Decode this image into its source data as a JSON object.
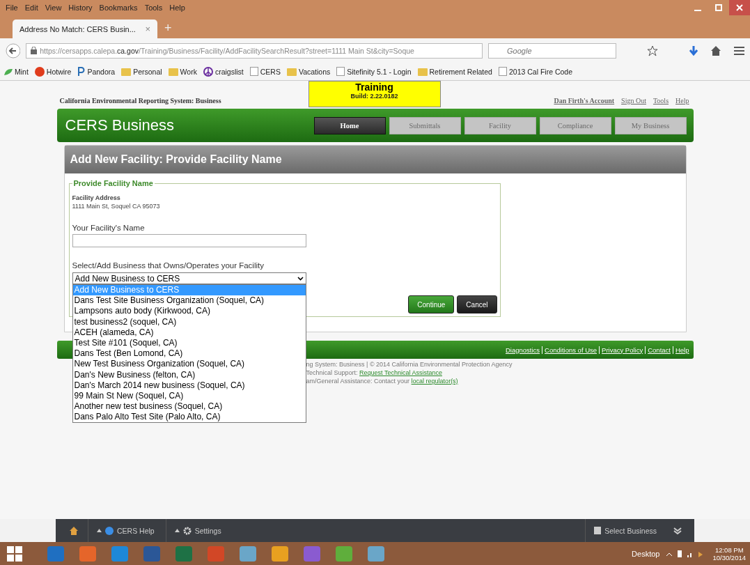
{
  "browser": {
    "menu": [
      "File",
      "Edit",
      "View",
      "History",
      "Bookmarks",
      "Tools",
      "Help"
    ],
    "tab": {
      "title": "Address No Match: CERS Busin...",
      "close": "×"
    },
    "new_tab": "+",
    "url": {
      "prefix": "https://cersapps.calepa.",
      "domain": "ca.gov",
      "path": "/Training/Business/Facility/AddFacilitySearchResult?street=1111 Main St&city=Soque"
    },
    "search": {
      "placeholder": "Google"
    },
    "bookmarks": [
      {
        "label": "Mint",
        "kind": "leaf"
      },
      {
        "label": "Hotwire",
        "kind": "site"
      },
      {
        "label": "Pandora",
        "kind": "letter"
      },
      {
        "label": "Personal",
        "kind": "folder"
      },
      {
        "label": "Work",
        "kind": "folder"
      },
      {
        "label": "craigslist",
        "kind": "peace"
      },
      {
        "label": "CERS",
        "kind": "page"
      },
      {
        "label": "Vacations",
        "kind": "folder"
      },
      {
        "label": "Sitefinity 5.1 - Login",
        "kind": "page"
      },
      {
        "label": "Retirement Related",
        "kind": "folder"
      },
      {
        "label": "2013 Cal Fire Code",
        "kind": "page"
      }
    ]
  },
  "page": {
    "system_title": "California Environmental Reporting System: Business",
    "training_banner": {
      "title": "Training",
      "build": "Build: 2.22.0182"
    },
    "account_links": [
      "Dan Firth's Account",
      "Sign Out",
      "Tools",
      "Help"
    ],
    "app_title": "CERS Business",
    "nav": [
      {
        "label": "Home",
        "selected": true
      },
      {
        "label": "Submittals",
        "selected": false
      },
      {
        "label": "Facility",
        "selected": false
      },
      {
        "label": "Compliance",
        "selected": false
      },
      {
        "label": "My Business",
        "selected": false
      }
    ],
    "panel_title": "Add New Facility: Provide Facility Name",
    "legend": "Provide Facility Name",
    "address_label": "Facility Address",
    "address": "1111 Main St, Soquel CA 95073",
    "name_label": "Your Facility's Name",
    "select_label": "Select/Add Business that Owns/Operates your Facility",
    "select_value": "Add New Business to CERS",
    "options": [
      {
        "label": "Add New Business to CERS",
        "selected": true
      },
      {
        "label": "Dans Test Site Business Organization (Soquel, CA)",
        "selected": false
      },
      {
        "label": "Lampsons auto body (Kirkwood, CA)",
        "selected": false
      },
      {
        "label": "test business2 (soquel, CA)",
        "selected": false
      },
      {
        "label": "ACEH (alameda, CA)",
        "selected": false
      },
      {
        "label": "Test Site #101 (Soquel, CA)",
        "selected": false
      },
      {
        "label": "Dans Test (Ben Lomond, CA)",
        "selected": false
      },
      {
        "label": "New Test Business Organization (Soquel, CA)",
        "selected": false
      },
      {
        "label": "Dan's New Business (felton, CA)",
        "selected": false
      },
      {
        "label": "Dan's March 2014 new business (Soquel, CA)",
        "selected": false
      },
      {
        "label": "99 Main St New (Soquel, CA)",
        "selected": false
      },
      {
        "label": "Another new test business (Soquel, CA)",
        "selected": false
      },
      {
        "label": "Dans Palo Alto Test Site (Palo Alto, CA)",
        "selected": false
      }
    ],
    "buttons": [
      {
        "label": "Continue",
        "kind": "primary"
      },
      {
        "label": "Cancel",
        "kind": "secondary"
      }
    ],
    "footer_links": [
      "Diagnostics",
      "Conditions of Use",
      "Privacy Policy",
      "Contact",
      "Help"
    ],
    "footer_lines": [
      {
        "text": "ng System: Business | © 2014 California Environmental Protection Agency"
      },
      {
        "text": "Technical Support:",
        "link": "Request Technical Assistance"
      },
      {
        "text": "am/General Assistance: Contact your",
        "link": "local regulator(s)"
      }
    ]
  },
  "bottom_toolbar": {
    "items": [
      {
        "label": "CERS Help",
        "kind": "help"
      },
      {
        "label": "Settings",
        "kind": "gear"
      }
    ],
    "select_business": "Select Business"
  },
  "taskbar": {
    "apps": [
      {
        "color": "#1f6fc1"
      },
      {
        "color": "#e5652a"
      },
      {
        "color": "#1e88d8"
      },
      {
        "color": "#2b5797"
      },
      {
        "color": "#1e7145"
      },
      {
        "color": "#d24726"
      },
      {
        "color": "#6aa6c8"
      },
      {
        "color": "#e8a020"
      },
      {
        "color": "#8a5bd0"
      },
      {
        "color": "#5fae3c"
      },
      {
        "color": "#6aa6c8"
      }
    ],
    "desktop": "Desktop",
    "time": "12:08 PM",
    "date": "10/30/2014"
  }
}
